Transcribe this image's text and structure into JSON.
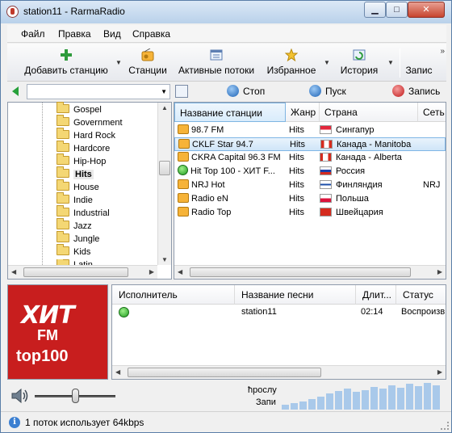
{
  "window": {
    "title": "station11 - RarmaRadio"
  },
  "menu": [
    "Файл",
    "Правка",
    "Вид",
    "Справка"
  ],
  "toolbar": {
    "add_station": "Добавить станцию",
    "stations": "Станции",
    "active_streams": "Активные потоки",
    "favorites": "Избранное",
    "history": "История",
    "record": "Запис"
  },
  "nav": {
    "stop": "Стоп",
    "play": "Пуск",
    "record": "Запись",
    "search_value": ""
  },
  "genres": [
    "Gospel",
    "Government",
    "Hard Rock",
    "Hardcore",
    "Hip-Hop",
    "Hits",
    "House",
    "Indie",
    "Industrial",
    "Jazz",
    "Jungle",
    "Kids",
    "Latin"
  ],
  "selected_genre": "Hits",
  "stations_table": {
    "columns": [
      "Название станции",
      "Жанр",
      "Страна",
      "Сеть"
    ],
    "rows": [
      {
        "name": "98.7 FM",
        "genre": "Hits",
        "country": "Сингапур",
        "network": "",
        "icon": "radio-icon",
        "flag": "singapore-flag-icon"
      },
      {
        "name": "CKLF Star 94.7",
        "genre": "Hits",
        "country": "Канада - Manitoba",
        "network": "",
        "icon": "radio-icon",
        "flag": "canada-flag-icon"
      },
      {
        "name": "CKRA Capital 96.3 FM",
        "genre": "Hits",
        "country": "Канада - Alberta",
        "network": "",
        "icon": "radio-icon",
        "flag": "canada-flag-icon"
      },
      {
        "name": "Hit Top 100 - ХИТ F...",
        "genre": "Hits",
        "country": "Россия",
        "network": "",
        "icon": "playing-icon",
        "flag": "russia-flag-icon"
      },
      {
        "name": "NRJ Hot",
        "genre": "Hits",
        "country": "Финляндия",
        "network": "NRJ",
        "icon": "radio-icon",
        "flag": "finland-flag-icon"
      },
      {
        "name": "Radio eN",
        "genre": "Hits",
        "country": "Польша",
        "network": "",
        "icon": "radio-icon",
        "flag": "poland-flag-icon"
      },
      {
        "name": "Radio Top",
        "genre": "Hits",
        "country": "Швейцария",
        "network": "",
        "icon": "radio-icon",
        "flag": "switzerland-flag-icon"
      }
    ]
  },
  "cover": {
    "line1": "ХИТ",
    "line2": "FM",
    "line3": "top100"
  },
  "tracks_table": {
    "columns": [
      "Исполнитель",
      "Название песни",
      "Длит...",
      "Статус"
    ],
    "rows": [
      {
        "artist": "",
        "song": "station11",
        "duration": "02:14",
        "status": "Воспроизв"
      }
    ]
  },
  "recorder": {
    "label_top": "ћрослу",
    "label_bottom": "Запи"
  },
  "status": {
    "text": "1 поток использует 64kbps"
  },
  "colors": {
    "accent": "#3b7fd1",
    "selection": "#cfe5f8",
    "cover": "#c81e1e"
  }
}
